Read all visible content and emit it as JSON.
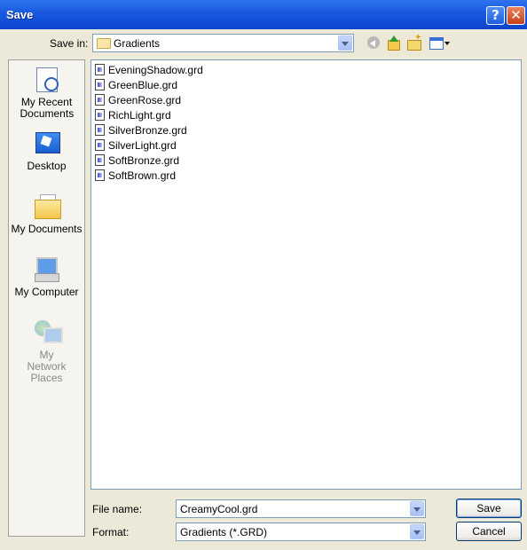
{
  "window": {
    "title": "Save"
  },
  "toolbar": {
    "save_in_label": "Save in:",
    "save_in_value": "Gradients"
  },
  "places": [
    {
      "label": "My Recent Documents"
    },
    {
      "label": "Desktop"
    },
    {
      "label": "My Documents"
    },
    {
      "label": "My Computer"
    },
    {
      "label": "My Network Places"
    }
  ],
  "files": [
    "EveningShadow.grd",
    "GreenBlue.grd",
    "GreenRose.grd",
    "RichLight.grd",
    "SilverBronze.grd",
    "SilverLight.grd",
    "SoftBronze.grd",
    "SoftBrown.grd"
  ],
  "form": {
    "file_name_label": "File name:",
    "file_name_value": "CreamyCool.grd",
    "format_label": "Format:",
    "format_value": "Gradients (*.GRD)"
  },
  "buttons": {
    "save": "Save",
    "cancel": "Cancel"
  },
  "icons": {
    "help": "?",
    "close": "✕"
  }
}
